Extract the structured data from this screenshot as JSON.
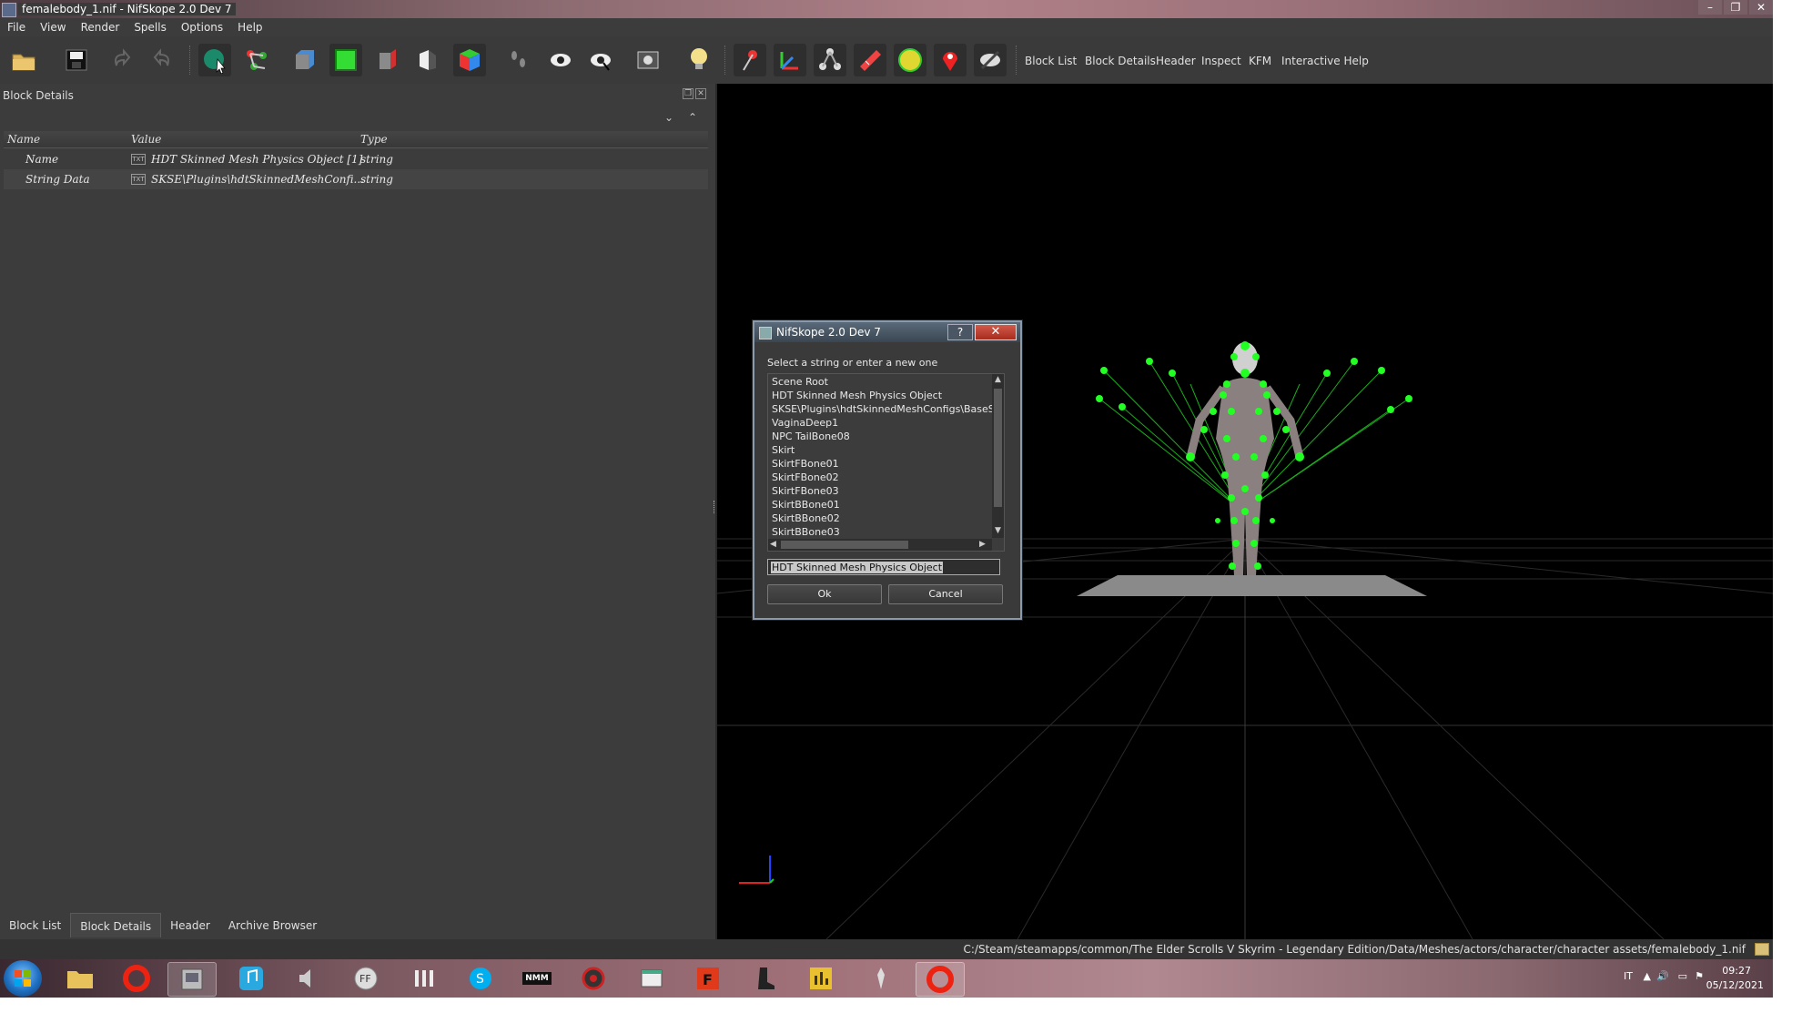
{
  "window": {
    "title": "femalebody_1.nif - NifSkope 2.0 Dev 7",
    "buttons": [
      "–",
      "❐",
      "✕"
    ]
  },
  "menubar": [
    "File",
    "View",
    "Render",
    "Spells",
    "Options",
    "Help"
  ],
  "toolbar": {
    "text_buttons": [
      "Block List",
      "Block Details",
      "Header",
      "Inspect",
      "KFM",
      "Interactive Help"
    ]
  },
  "panel": {
    "title": "Block Details",
    "columns": [
      "Name",
      "Value",
      "Type"
    ],
    "rows": [
      {
        "name": "Name",
        "value": "HDT Skinned Mesh Physics Object [1]",
        "type": "string"
      },
      {
        "name": "String Data",
        "value": "SKSE\\Plugins\\hdtSkinnedMeshConfi...",
        "type": "string"
      }
    ]
  },
  "bottom_tabs": [
    "Block List",
    "Block Details",
    "Header",
    "Archive Browser"
  ],
  "statusbar": {
    "path": "C:/Steam/steamapps/common/The Elder Scrolls V Skyrim - Legendary Edition/Data/Meshes/actors/character/character assets/femalebody_1.nif"
  },
  "dialog": {
    "title": "NifSkope 2.0 Dev 7",
    "help_label": "?",
    "close_label": "✕",
    "prompt": "Select a string or enter a new one",
    "items": [
      "Scene Root",
      "HDT Skinned Mesh Physics Object",
      "SKSE\\Plugins\\hdtSkinnedMeshConfigs\\BaseS",
      "VaginaDeep1",
      "NPC TailBone08",
      "Skirt",
      "SkirtFBone01",
      "SkirtFBone02",
      "SkirtFBone03",
      "SkirtBBone01",
      "SkirtBBone02",
      "SkirtBBone03"
    ],
    "input_value": "HDT Skinned Mesh Physics Object",
    "ok_label": "Ok",
    "cancel_label": "Cancel"
  },
  "taskbar": {
    "items": [
      "nmm-label"
    ],
    "nmm_label": "NMM",
    "lang": "IT",
    "time": "09:27",
    "date": "05/12/2021"
  },
  "colors": {
    "viewport_bg": "#000000",
    "bone_green": "#22ff22",
    "panel_bg": "#3c3c3c"
  }
}
